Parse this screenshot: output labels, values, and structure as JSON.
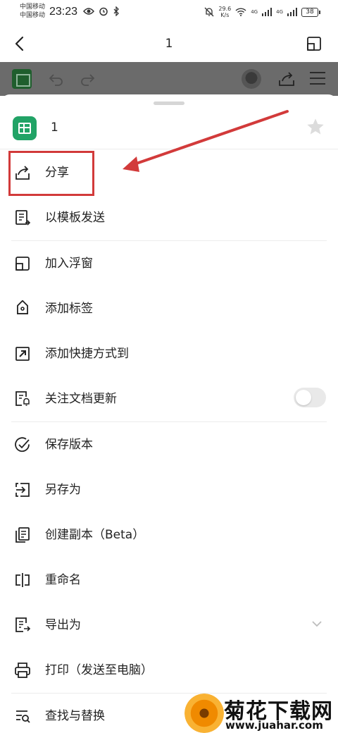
{
  "status_bar": {
    "carrier_1": "中国移动",
    "carrier_2": "中国移动",
    "time": "23:23",
    "speed_value": "29.6",
    "speed_unit": "K/s",
    "network_1": "4G",
    "network_2": "4G",
    "battery": "38"
  },
  "nav": {
    "title": "1"
  },
  "document": {
    "name": "1"
  },
  "menu": {
    "items": [
      {
        "label": "分享",
        "icon": "share-icon"
      },
      {
        "label": "以模板发送",
        "icon": "template-send-icon"
      },
      {
        "label": "加入浮窗",
        "icon": "floating-window-icon"
      },
      {
        "label": "添加标签",
        "icon": "tag-icon"
      },
      {
        "label": "添加快捷方式到",
        "icon": "shortcut-icon"
      },
      {
        "label": "关注文档更新",
        "icon": "follow-updates-icon",
        "toggle": false
      },
      {
        "label": "保存版本",
        "icon": "check-circle-icon"
      },
      {
        "label": "另存为",
        "icon": "save-as-icon"
      },
      {
        "label": "创建副本（Beta）",
        "icon": "copy-icon"
      },
      {
        "label": "重命名",
        "icon": "rename-icon"
      },
      {
        "label": "导出为",
        "icon": "export-icon"
      },
      {
        "label": "打印（发送至电脑）",
        "icon": "print-icon"
      },
      {
        "label": "查找与替换",
        "icon": "find-replace-icon"
      }
    ]
  },
  "watermark": {
    "title": "菊花下载网",
    "url": "www.juahar.com"
  },
  "colors": {
    "accent_green": "#21a366",
    "annotation_red": "#d23a3a"
  }
}
